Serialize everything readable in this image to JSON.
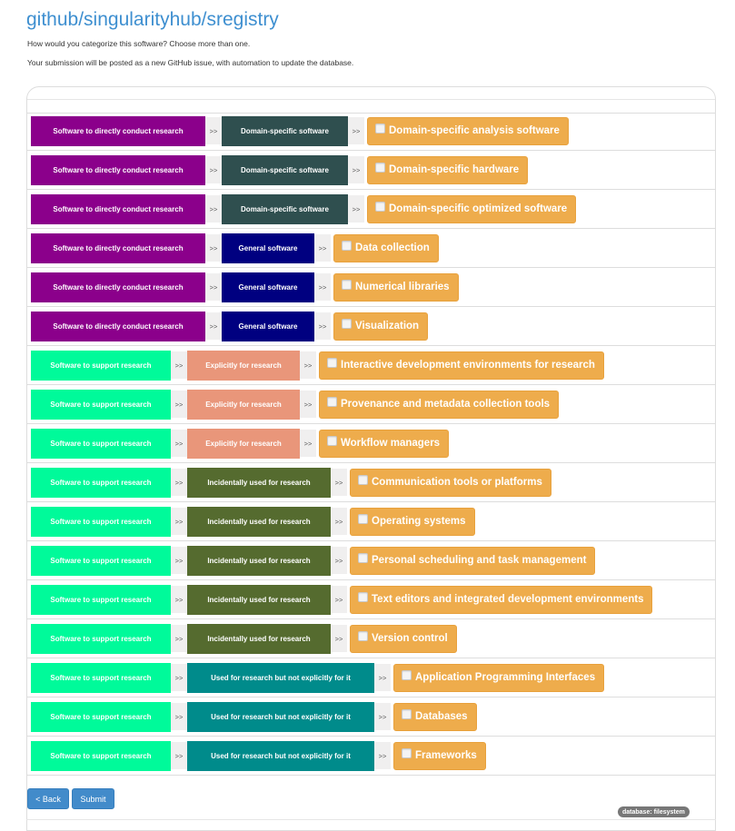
{
  "header": {
    "title": "github/singularityhub/sregistry",
    "prompt": "How would you categorize this software? Choose more than one.",
    "note": "Your submission will be posted as a new GitHub issue, with automation to update the database."
  },
  "separator": ">>",
  "colors": {
    "direct_research": "#8b008b",
    "domain_specific": "#2f4f4f",
    "general_software": "#000080",
    "support_research": "#00fa9a",
    "explicitly_for_research": "#e9967a",
    "incidentally_used": "#556b2f",
    "used_not_explicitly": "#008b8b",
    "leaf": "#eeac4c"
  },
  "rows": [
    {
      "level1": "Software to directly conduct research",
      "level1_color": "#8b008b",
      "level2": "Domain-specific software",
      "level2_color": "#2f4f4f",
      "leaf": "Domain-specific analysis software",
      "checked": false
    },
    {
      "level1": "Software to directly conduct research",
      "level1_color": "#8b008b",
      "level2": "Domain-specific software",
      "level2_color": "#2f4f4f",
      "leaf": "Domain-specific hardware",
      "checked": false
    },
    {
      "level1": "Software to directly conduct research",
      "level1_color": "#8b008b",
      "level2": "Domain-specific software",
      "level2_color": "#2f4f4f",
      "leaf": "Domain-specific optimized software",
      "checked": false
    },
    {
      "level1": "Software to directly conduct research",
      "level1_color": "#8b008b",
      "level2": "General software",
      "level2_color": "#000080",
      "leaf": "Data collection",
      "checked": false
    },
    {
      "level1": "Software to directly conduct research",
      "level1_color": "#8b008b",
      "level2": "General software",
      "level2_color": "#000080",
      "leaf": "Numerical libraries",
      "checked": false
    },
    {
      "level1": "Software to directly conduct research",
      "level1_color": "#8b008b",
      "level2": "General software",
      "level2_color": "#000080",
      "leaf": "Visualization",
      "checked": false
    },
    {
      "level1": "Software to support research",
      "level1_color": "#00fa9a",
      "level2": "Explicitly for research",
      "level2_color": "#e9967a",
      "leaf": "Interactive development environments for research",
      "checked": false
    },
    {
      "level1": "Software to support research",
      "level1_color": "#00fa9a",
      "level2": "Explicitly for research",
      "level2_color": "#e9967a",
      "leaf": "Provenance and metadata collection tools",
      "checked": false
    },
    {
      "level1": "Software to support research",
      "level1_color": "#00fa9a",
      "level2": "Explicitly for research",
      "level2_color": "#e9967a",
      "leaf": "Workflow managers",
      "checked": false
    },
    {
      "level1": "Software to support research",
      "level1_color": "#00fa9a",
      "level2": "Incidentally used for research",
      "level2_color": "#556b2f",
      "leaf": "Communication tools or platforms",
      "checked": false
    },
    {
      "level1": "Software to support research",
      "level1_color": "#00fa9a",
      "level2": "Incidentally used for research",
      "level2_color": "#556b2f",
      "leaf": "Operating systems",
      "checked": false
    },
    {
      "level1": "Software to support research",
      "level1_color": "#00fa9a",
      "level2": "Incidentally used for research",
      "level2_color": "#556b2f",
      "leaf": "Personal scheduling and task management",
      "checked": false
    },
    {
      "level1": "Software to support research",
      "level1_color": "#00fa9a",
      "level2": "Incidentally used for research",
      "level2_color": "#556b2f",
      "leaf": "Text editors and integrated development environments",
      "checked": false
    },
    {
      "level1": "Software to support research",
      "level1_color": "#00fa9a",
      "level2": "Incidentally used for research",
      "level2_color": "#556b2f",
      "leaf": "Version control",
      "checked": false
    },
    {
      "level1": "Software to support research",
      "level1_color": "#00fa9a",
      "level2": "Used for research but not explicitly for it",
      "level2_color": "#008b8b",
      "leaf": "Application Programming Interfaces",
      "checked": false
    },
    {
      "level1": "Software to support research",
      "level1_color": "#00fa9a",
      "level2": "Used for research but not explicitly for it",
      "level2_color": "#008b8b",
      "leaf": "Databases",
      "checked": false
    },
    {
      "level1": "Software to support research",
      "level1_color": "#00fa9a",
      "level2": "Used for research but not explicitly for it",
      "level2_color": "#008b8b",
      "leaf": "Frameworks",
      "checked": false
    }
  ],
  "buttons": {
    "back": "< Back",
    "submit": "Submit"
  },
  "badge": "database: filesystem"
}
